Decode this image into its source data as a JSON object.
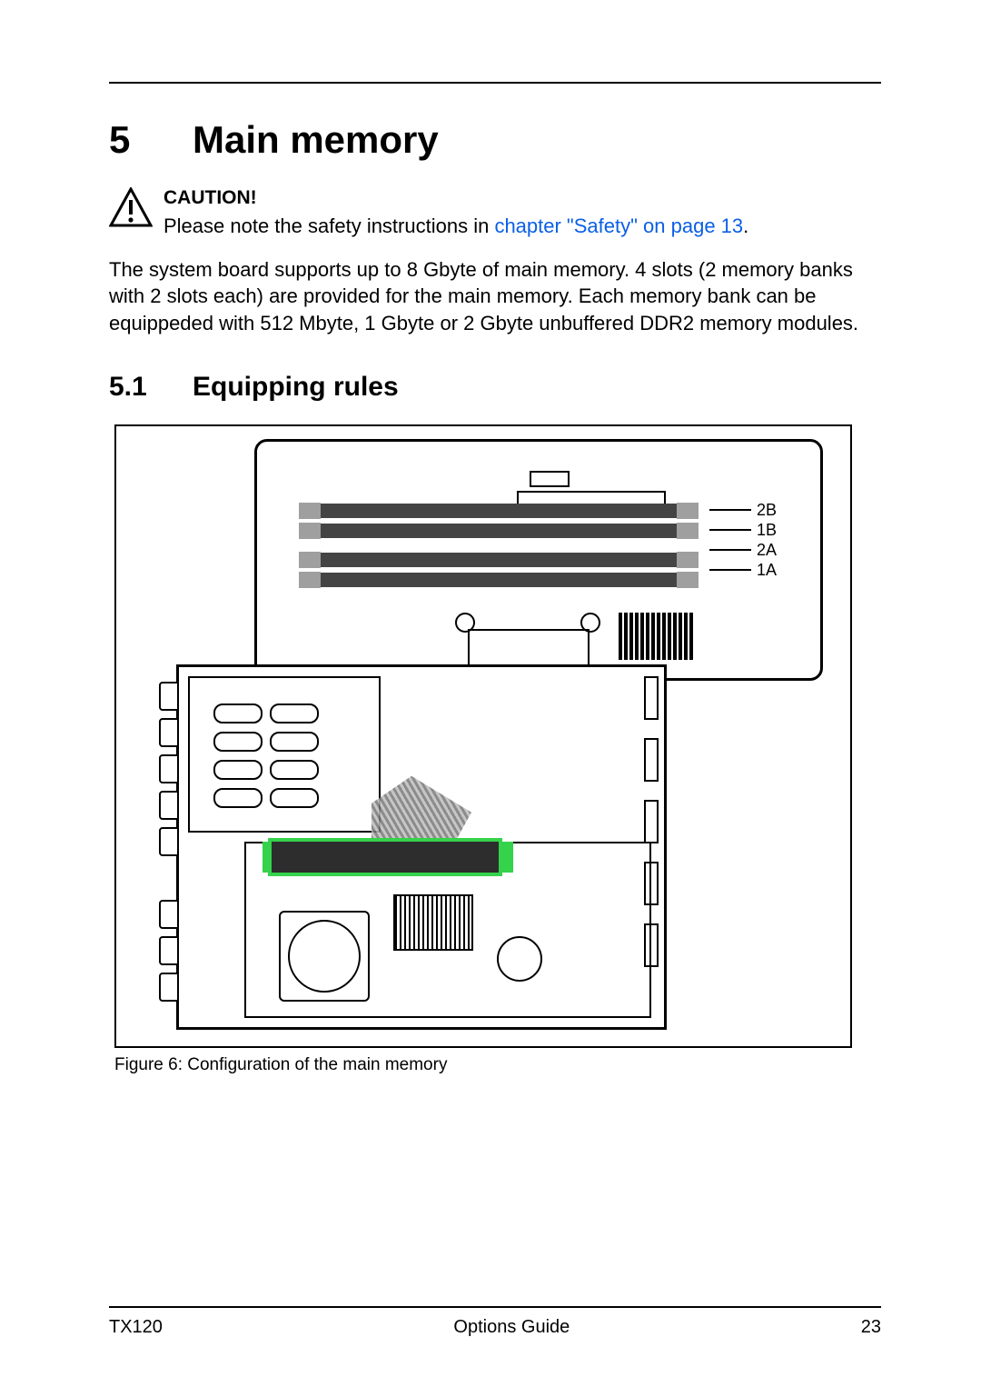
{
  "chapter": {
    "number": "5",
    "title": "Main memory"
  },
  "caution": {
    "label": "CAUTION!",
    "text_prefix": "Please note the safety instructions in ",
    "link_text": "chapter \"Safety\" on page 13",
    "text_suffix": "."
  },
  "body_paragraph": "The system board supports up to 8 Gbyte of main memory. 4 slots (2 memory banks with 2 slots each) are provided for the main memory. Each memory bank can be equippeded with 512 Mbyte, 1 Gbyte or 2 Gbyte unbuffered DDR2 memory modules.",
  "section": {
    "number": "5.1",
    "title": "Equipping rules"
  },
  "diagram": {
    "slot_labels": [
      "2B",
      "1B",
      "2A",
      "1A"
    ],
    "caption": "Figure 6: Configuration of the main memory"
  },
  "footer": {
    "model": "TX120",
    "doc_title": "Options Guide",
    "page_number": "23"
  }
}
